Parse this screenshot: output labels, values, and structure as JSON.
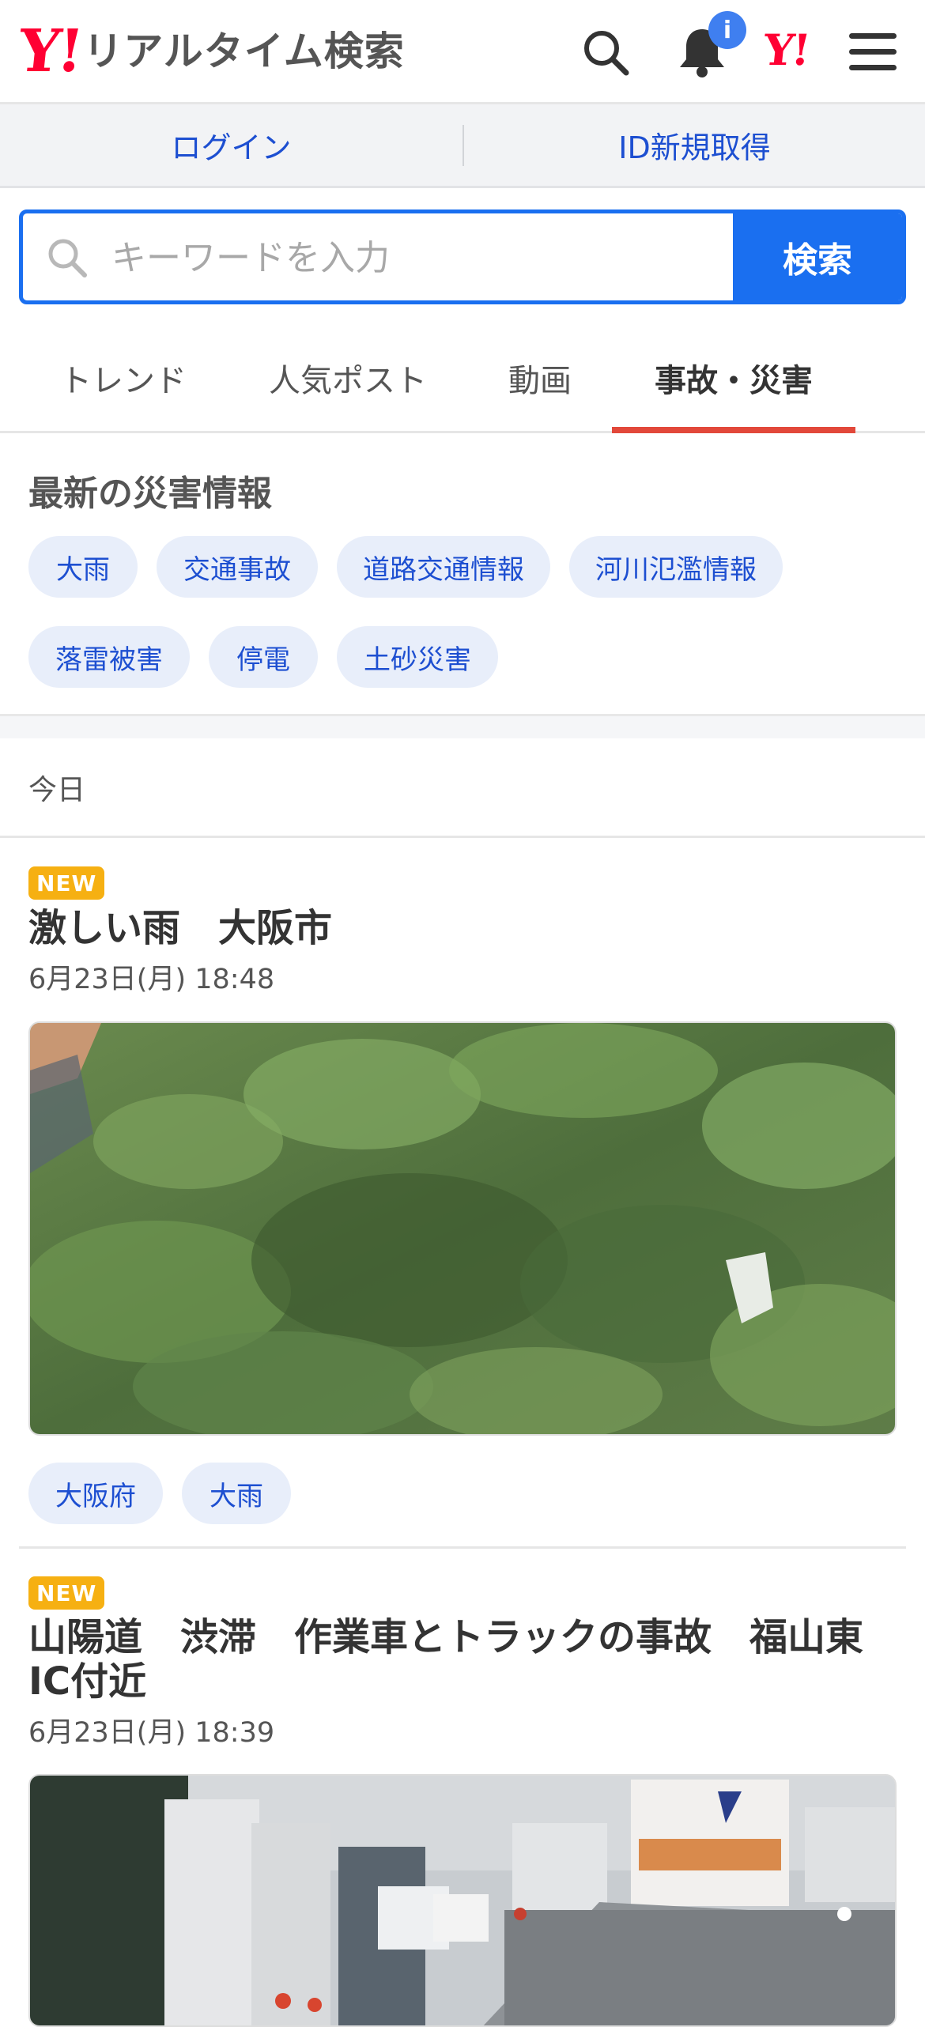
{
  "header": {
    "logo_mark": "Y!",
    "logo_text": "リアルタイム検索",
    "notification_badge": "i",
    "yahoo_mark": "Y!"
  },
  "auth": {
    "login": "ログイン",
    "signup": "ID新規取得"
  },
  "search": {
    "placeholder": "キーワードを入力",
    "button": "検索"
  },
  "tabs": [
    "トレンド",
    "人気ポスト",
    "動画",
    "事故・災害"
  ],
  "active_tab": "事故・災害",
  "disaster": {
    "title": "最新の災害情報",
    "chips": [
      "大雨",
      "交通事故",
      "道路交通情報",
      "河川氾濫情報",
      "落雷被害",
      "停電",
      "土砂災害"
    ]
  },
  "day_label": "今日",
  "articles": [
    {
      "badge": "NEW",
      "title": "激しい雨　大阪市",
      "date": "6月23日(月) 18:48",
      "tags": [
        "大阪府",
        "大雨"
      ]
    },
    {
      "badge": "NEW",
      "title": "山陽道　渋滞　作業車とトラックの事故　福山東IC付近",
      "date": "6月23日(月) 18:39"
    }
  ],
  "colors": {
    "brand_red": "#ff0033",
    "accent_blue": "#1a6ff0",
    "link_blue": "#1d4fd1",
    "tab_indicator": "#e2483a",
    "new_badge": "#f6b012"
  }
}
